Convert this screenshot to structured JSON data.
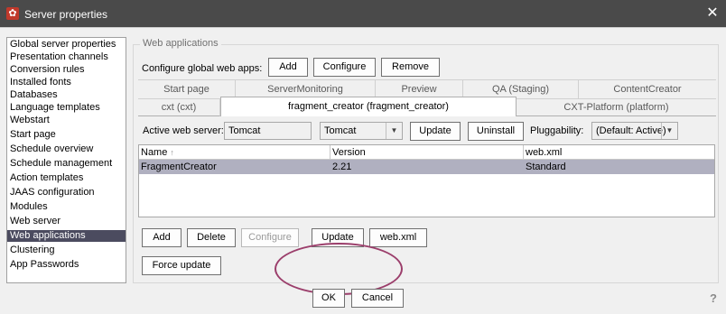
{
  "window": {
    "title": "Server properties",
    "close_glyph": "✕",
    "app_icon": "gear-icon"
  },
  "sidebar": {
    "items": [
      {
        "label": "Global server properties"
      },
      {
        "label": "Presentation channels"
      },
      {
        "label": "Conversion rules"
      },
      {
        "label": "Installed fonts"
      },
      {
        "label": "Databases"
      },
      {
        "label": "Language templates"
      },
      {
        "label": "Webstart"
      },
      {
        "label": "Start page"
      },
      {
        "label": "Schedule overview"
      },
      {
        "label": "Schedule management"
      },
      {
        "label": "Action templates"
      },
      {
        "label": "JAAS configuration"
      },
      {
        "label": "Modules"
      },
      {
        "label": "Web server"
      },
      {
        "label": "Web applications",
        "selected": true
      },
      {
        "label": "Clustering"
      },
      {
        "label": "App Passwords"
      }
    ]
  },
  "main": {
    "group_title": "Web applications",
    "global_label": "Configure global web apps:",
    "global_buttons": {
      "add": "Add",
      "configure": "Configure",
      "remove": "Remove"
    },
    "tabs_row1": [
      "Start page",
      "ServerMonitoring",
      "Preview",
      "QA (Staging)",
      "ContentCreator"
    ],
    "tabs_row2": [
      "cxt (cxt)",
      "fragment_creator (fragment_creator)",
      "CXT-Platform (platform)"
    ],
    "active_tab": "fragment_creator (fragment_creator)",
    "active_web_server_label": "Active web server:",
    "active_web_server_value": "Tomcat",
    "server_select": "Tomcat",
    "update_label": "Update",
    "uninstall_label": "Uninstall",
    "pluggability_label": "Pluggability:",
    "pluggability_value": "(Default: Active)",
    "table": {
      "headers": [
        "Name",
        "Version",
        "web.xml"
      ],
      "sort_indicator": "↑",
      "rows": [
        [
          "FragmentCreator",
          "2.21",
          "Standard"
        ]
      ]
    },
    "bottom_buttons": {
      "add": "Add",
      "delete": "Delete",
      "configure": "Configure",
      "update": "Update",
      "webxml": "web.xml"
    },
    "force_update": "Force update"
  },
  "footer": {
    "ok": "OK",
    "cancel": "Cancel",
    "help_glyph": "?"
  },
  "colors": {
    "selection": "#4b4b5f",
    "title_bar": "#4a4a4a",
    "highlight_ellipse": "#9b3e6b",
    "row_selected": "#b0b0c0"
  }
}
